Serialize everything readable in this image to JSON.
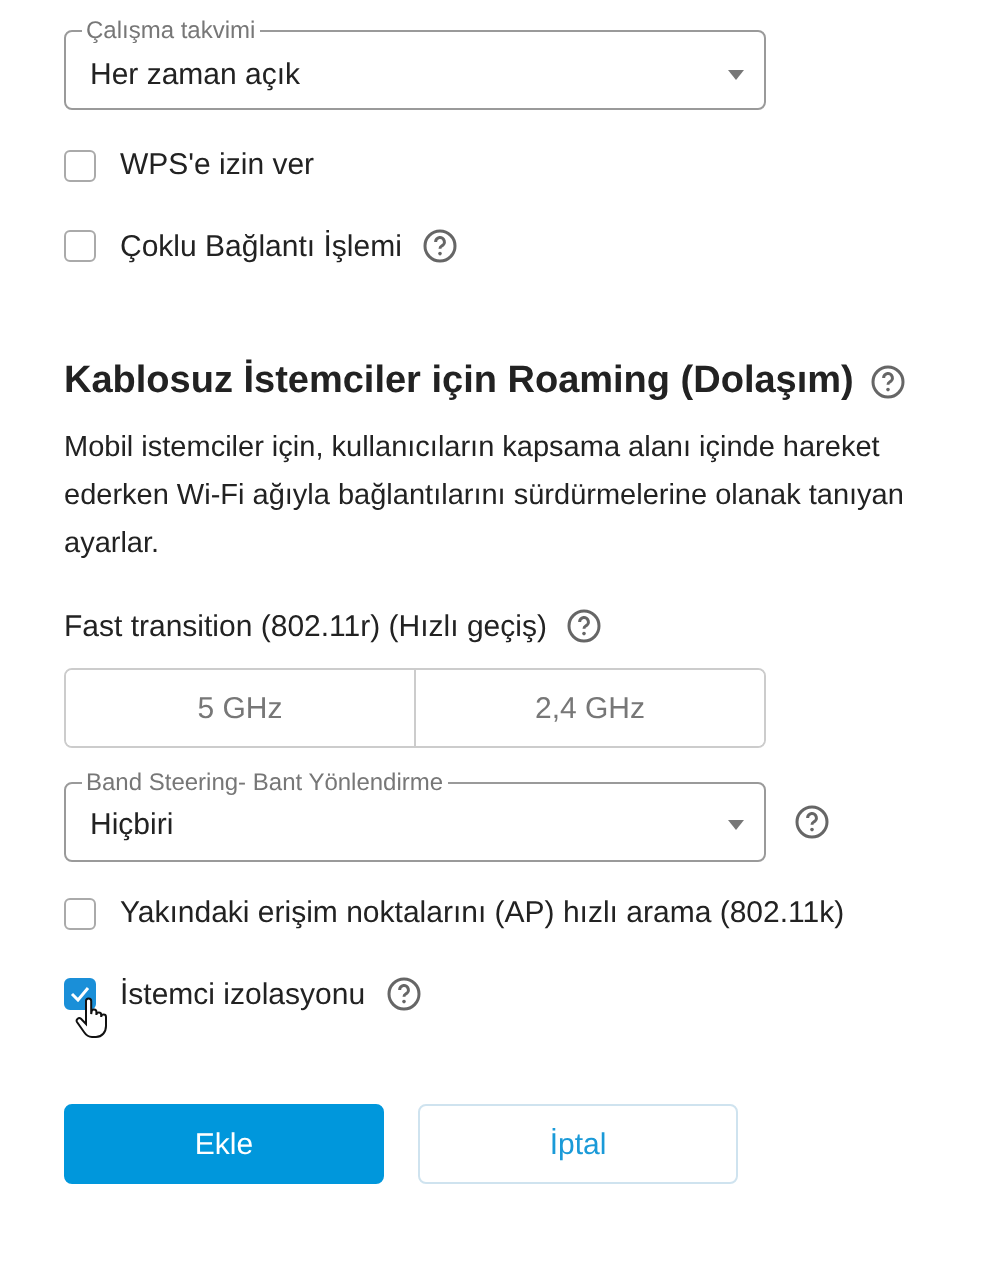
{
  "schedule_select": {
    "label": "Çalışma takvimi",
    "value": "Her zaman açık"
  },
  "options_top": [
    {
      "label": "WPS'e izin ver",
      "checked": false,
      "help": false
    },
    {
      "label": "Çoklu Bağlantı İşlemi",
      "checked": false,
      "help": true
    }
  ],
  "roaming": {
    "title": "Kablosuz İstemciler için Roaming (Dolaşım)",
    "description": "Mobil istemciler için, kullanıcıların kapsama alanı içinde hareket ederken Wi-Fi ağıyla bağlantılarını sürdürmelerine olanak tanıyan ayarlar.",
    "fast_transition": {
      "label": "Fast transition (802.11r) (Hızlı geçiş)",
      "bands": [
        {
          "label": "5 GHz",
          "selected": false
        },
        {
          "label": "2,4 GHz",
          "selected": false
        }
      ]
    },
    "band_steering": {
      "label": "Band Steering- Bant Yönlendirme",
      "value": "Hiçbiri"
    },
    "options": [
      {
        "label": "Yakındaki erişim noktalarını (AP) hızlı arama (802.11k)",
        "checked": false,
        "help": false
      },
      {
        "label": "İstemci izolasyonu",
        "checked": true,
        "help": true
      }
    ]
  },
  "buttons": [
    {
      "label": "Ekle",
      "kind": "primary"
    },
    {
      "label": "İptal",
      "kind": "secondary"
    }
  ]
}
